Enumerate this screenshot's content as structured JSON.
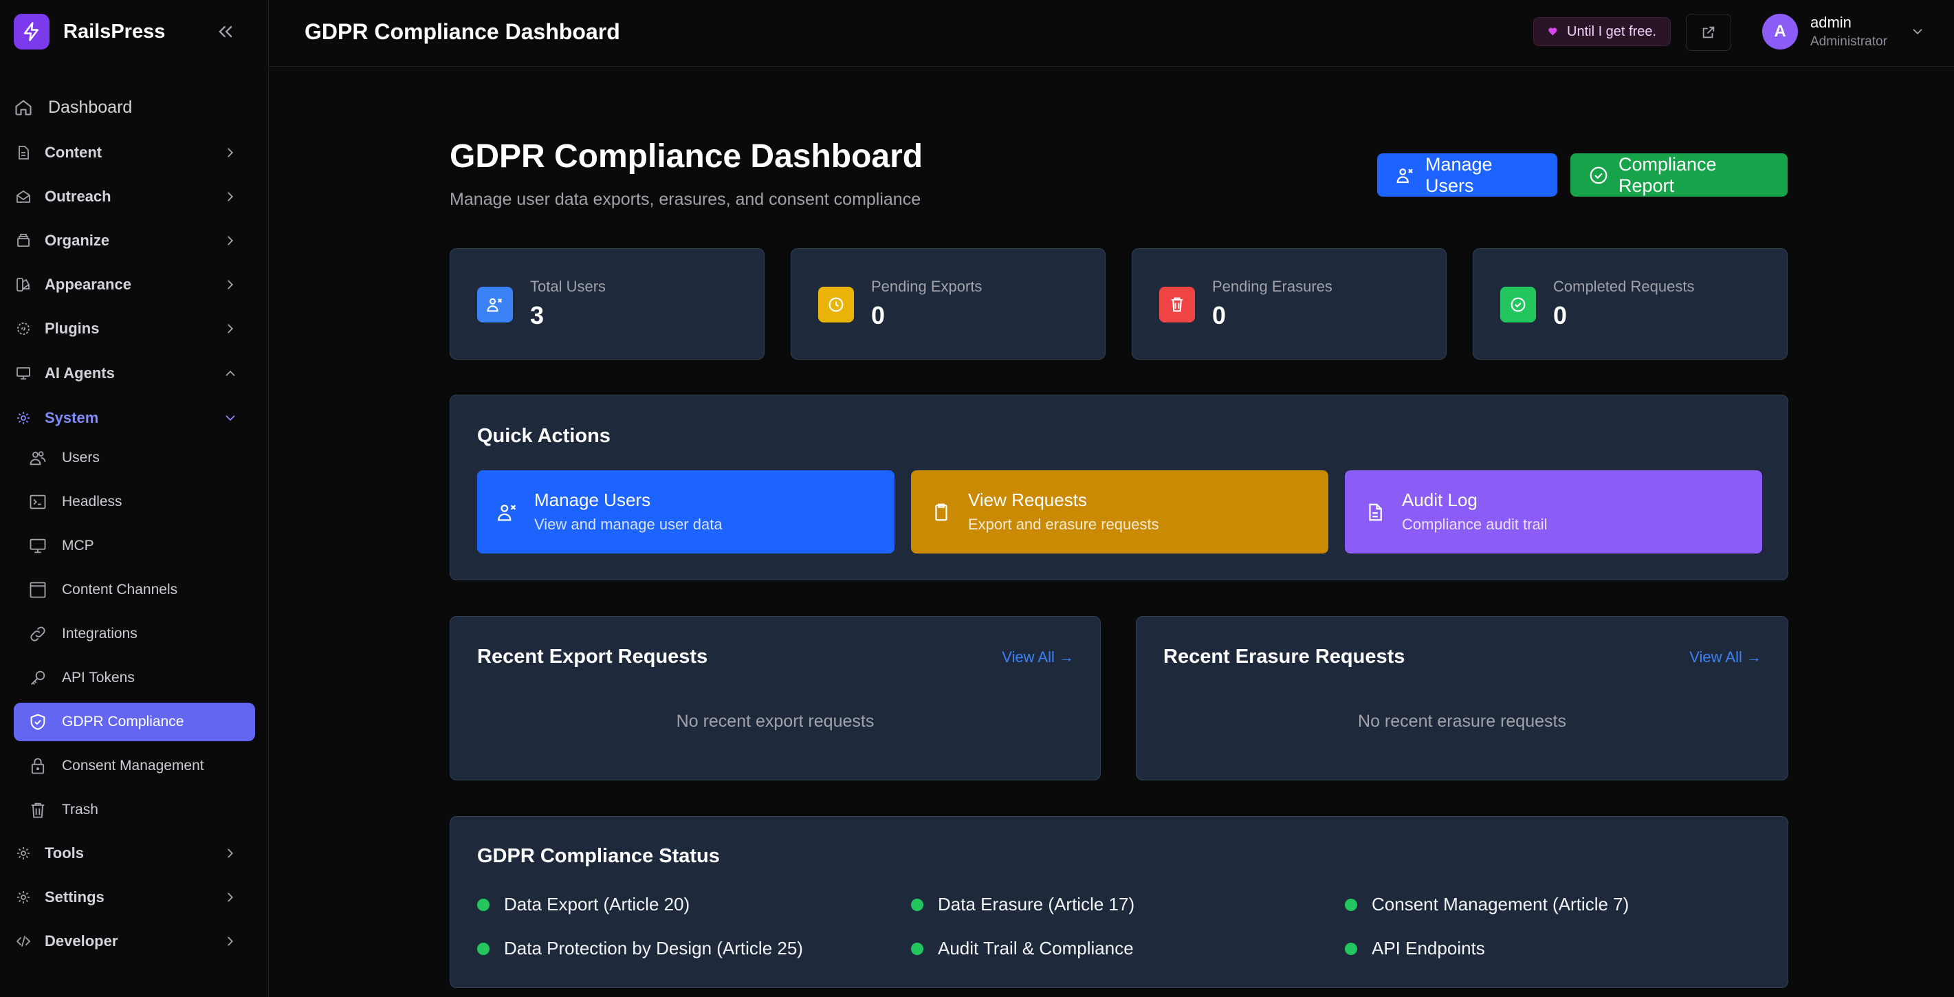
{
  "brand": {
    "name": "RailsPress"
  },
  "topbar": {
    "title": "GDPR Compliance Dashboard",
    "sponsor_text": "Until I get free.",
    "user": {
      "initial": "A",
      "name": "admin",
      "role": "Administrator"
    }
  },
  "sidebar": {
    "dashboard": "Dashboard",
    "items": [
      {
        "label": "Content",
        "icon": "file-icon"
      },
      {
        "label": "Outreach",
        "icon": "mail-open-icon"
      },
      {
        "label": "Organize",
        "icon": "archive-icon"
      },
      {
        "label": "Appearance",
        "icon": "swatch-icon"
      },
      {
        "label": "Plugins",
        "icon": "plugin-icon"
      },
      {
        "label": "AI Agents",
        "icon": "monitor-icon"
      },
      {
        "label": "System",
        "icon": "gear-icon"
      }
    ],
    "system_children": [
      {
        "label": "Users",
        "icon": "users-icon"
      },
      {
        "label": "Headless",
        "icon": "terminal-icon"
      },
      {
        "label": "MCP",
        "icon": "monitor-icon"
      },
      {
        "label": "Content Channels",
        "icon": "window-icon"
      },
      {
        "label": "Integrations",
        "icon": "link-icon"
      },
      {
        "label": "API Tokens",
        "icon": "key-icon"
      },
      {
        "label": "GDPR Compliance",
        "icon": "shield-check-icon"
      },
      {
        "label": "Consent Management",
        "icon": "lock-icon"
      },
      {
        "label": "Trash",
        "icon": "trash-icon"
      }
    ],
    "bottom_items": [
      {
        "label": "Tools",
        "icon": "gear-icon"
      },
      {
        "label": "Settings",
        "icon": "gear-icon"
      },
      {
        "label": "Developer",
        "icon": "code-icon"
      }
    ]
  },
  "main": {
    "title": "GDPR Compliance Dashboard",
    "subtitle": "Manage user data exports, erasures, and consent compliance",
    "buttons": {
      "manage_users": "Manage Users",
      "compliance_report": "Compliance Report"
    },
    "stats": [
      {
        "label": "Total Users",
        "value": "3",
        "color": "#3b82f6",
        "icon": "users-icon"
      },
      {
        "label": "Pending Exports",
        "value": "0",
        "color": "#eab308",
        "icon": "clock-icon"
      },
      {
        "label": "Pending Erasures",
        "value": "0",
        "color": "#ef4444",
        "icon": "trash-icon"
      },
      {
        "label": "Completed Requests",
        "value": "0",
        "color": "#22c55e",
        "icon": "check-circle-icon"
      }
    ],
    "quick_actions": {
      "heading": "Quick Actions",
      "items": [
        {
          "title": "Manage Users",
          "desc": "View and manage user data",
          "color": "#1d63ff",
          "icon": "users-icon"
        },
        {
          "title": "View Requests",
          "desc": "Export and erasure requests",
          "color": "#ca8a04",
          "icon": "clipboard-icon"
        },
        {
          "title": "Audit Log",
          "desc": "Compliance audit trail",
          "color": "#8b5cf6",
          "icon": "document-icon"
        }
      ]
    },
    "recent_exports": {
      "heading": "Recent Export Requests",
      "view_all": "View All →",
      "empty": "No recent export requests"
    },
    "recent_erasures": {
      "heading": "Recent Erasure Requests",
      "view_all": "View All →",
      "empty": "No recent erasure requests"
    },
    "status": {
      "heading": "GDPR Compliance Status",
      "items": [
        "Data Export (Article 20)",
        "Data Erasure (Article 17)",
        "Consent Management (Article 7)",
        "Data Protection by Design (Article 25)",
        "Audit Trail & Compliance",
        "API Endpoints"
      ]
    }
  }
}
